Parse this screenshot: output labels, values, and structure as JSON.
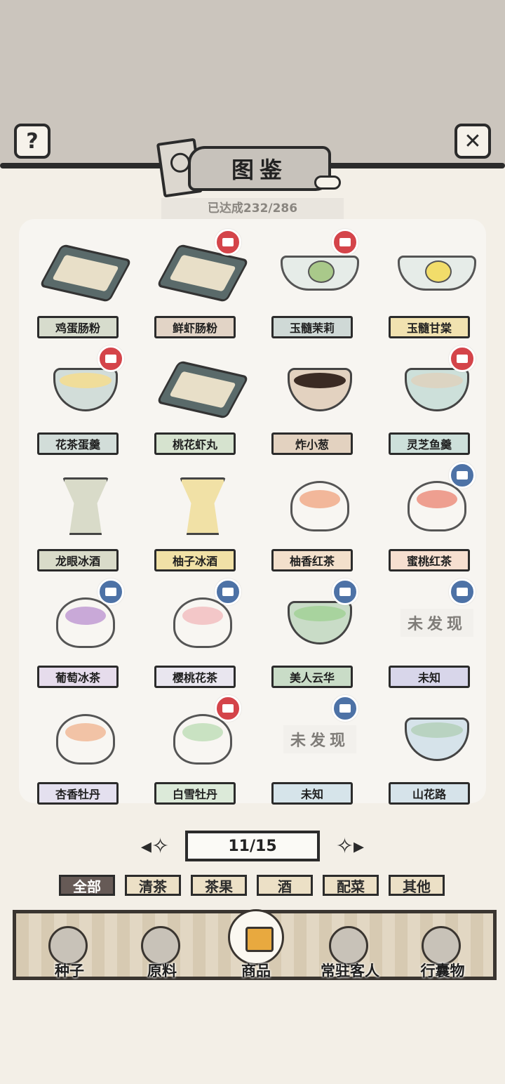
{
  "header": {
    "help_icon": "question-mark-icon",
    "close_icon": "close-x-icon",
    "title": "图鉴",
    "progress": "已达成232/286"
  },
  "items": [
    {
      "name": "鸡蛋肠粉",
      "dish": "tray",
      "plate_color": "#d7dccd",
      "badge": "",
      "undiscovered": ""
    },
    {
      "name": "鲜虾肠粉",
      "dish": "tray",
      "plate_color": "#e2d4c6",
      "badge": "red",
      "undiscovered": ""
    },
    {
      "name": "玉髓茉莉",
      "dish": "plate",
      "plate_color": "#cfd9d6",
      "ball_color": "#a9c98a",
      "badge": "red",
      "undiscovered": ""
    },
    {
      "name": "玉髓甘棠",
      "dish": "plate",
      "plate_color": "#f1e2b0",
      "ball_color": "#f2dd6a",
      "badge": "",
      "undiscovered": ""
    },
    {
      "name": "花茶蛋羹",
      "dish": "bowl",
      "plate_color": "#d2ddd9",
      "soup_color": "#f0dd9a",
      "badge": "red",
      "undiscovered": ""
    },
    {
      "name": "桃花虾丸",
      "dish": "tray",
      "plate_color": "#d6e3cf",
      "badge": "",
      "undiscovered": ""
    },
    {
      "name": "炸小葱",
      "dish": "bowl",
      "plate_color": "#e3d2c0",
      "soup_color": "#3b2b24",
      "badge": "",
      "undiscovered": ""
    },
    {
      "name": "灵芝鱼羹",
      "dish": "bowl",
      "plate_color": "#cde0da",
      "soup_color": "#dcd4c2",
      "badge": "red",
      "undiscovered": ""
    },
    {
      "name": "龙眼冰酒",
      "dish": "cup",
      "plate_color": "#d9dbc9",
      "badge": "",
      "undiscovered": ""
    },
    {
      "name": "柚子冰酒",
      "dish": "cup",
      "plate_color": "#f1e1a6",
      "badge": "",
      "undiscovered": ""
    },
    {
      "name": "柚香红茶",
      "dish": "teacup",
      "plate_color": "#f3e0cc",
      "soup_color": "#f2b79a",
      "badge": "",
      "undiscovered": ""
    },
    {
      "name": "蜜桃红茶",
      "dish": "teacup",
      "plate_color": "#f6dfd0",
      "soup_color": "#ee9f90",
      "badge": "blue",
      "undiscovered": ""
    },
    {
      "name": "葡萄冰茶",
      "dish": "teacup",
      "plate_color": "#e6dcec",
      "soup_color": "#c9a9d8",
      "badge": "blue",
      "undiscovered": ""
    },
    {
      "name": "樱桃花茶",
      "dish": "teacup",
      "plate_color": "#e9e6ef",
      "soup_color": "#f3c7c8",
      "badge": "blue",
      "undiscovered": ""
    },
    {
      "name": "美人云华",
      "dish": "bowl",
      "plate_color": "#c9dcc7",
      "soup_color": "#a8d39e",
      "badge": "blue",
      "undiscovered": ""
    },
    {
      "name": "未知",
      "dish": "none",
      "plate_color": "#d8d6ea",
      "badge": "blue",
      "undiscovered": "未发现"
    },
    {
      "name": "杏香牡丹",
      "dish": "teacup",
      "plate_color": "#e4e0ef",
      "soup_color": "#f2c3a6",
      "badge": "",
      "undiscovered": ""
    },
    {
      "name": "白雪牡丹",
      "dish": "teacup",
      "plate_color": "#dcead9",
      "soup_color": "#c9e2c2",
      "badge": "red",
      "undiscovered": ""
    },
    {
      "name": "未知",
      "dish": "none",
      "plate_color": "#d6e4ea",
      "badge": "blue",
      "undiscovered": "未发现"
    },
    {
      "name": "山花路",
      "dish": "bowl",
      "plate_color": "#d6e3ea",
      "soup_color": "#b9d3c1",
      "badge": "",
      "undiscovered": ""
    }
  ],
  "badge_colors": {
    "red": "#d4444a",
    "blue": "#4d72a6"
  },
  "pager": {
    "prev_icon": "left-ornament-arrow-icon",
    "label": "11/15",
    "next_icon": "right-ornament-arrow-icon"
  },
  "filters": [
    {
      "label": "全部",
      "active": true
    },
    {
      "label": "清茶",
      "active": false
    },
    {
      "label": "茶果",
      "active": false
    },
    {
      "label": "酒",
      "active": false
    },
    {
      "label": "配菜",
      "active": false
    },
    {
      "label": "其他",
      "active": false
    }
  ],
  "bottom_nav": [
    {
      "label": "种子",
      "icon": "seed-jar-icon",
      "active": false
    },
    {
      "label": "原料",
      "icon": "leaf-icon",
      "active": false
    },
    {
      "label": "商品",
      "icon": "goods-box-icon",
      "active": true
    },
    {
      "label": "常驻客人",
      "icon": "guest-girl-icon",
      "active": false
    },
    {
      "label": "行囊物",
      "icon": "robe-icon",
      "active": false
    }
  ]
}
